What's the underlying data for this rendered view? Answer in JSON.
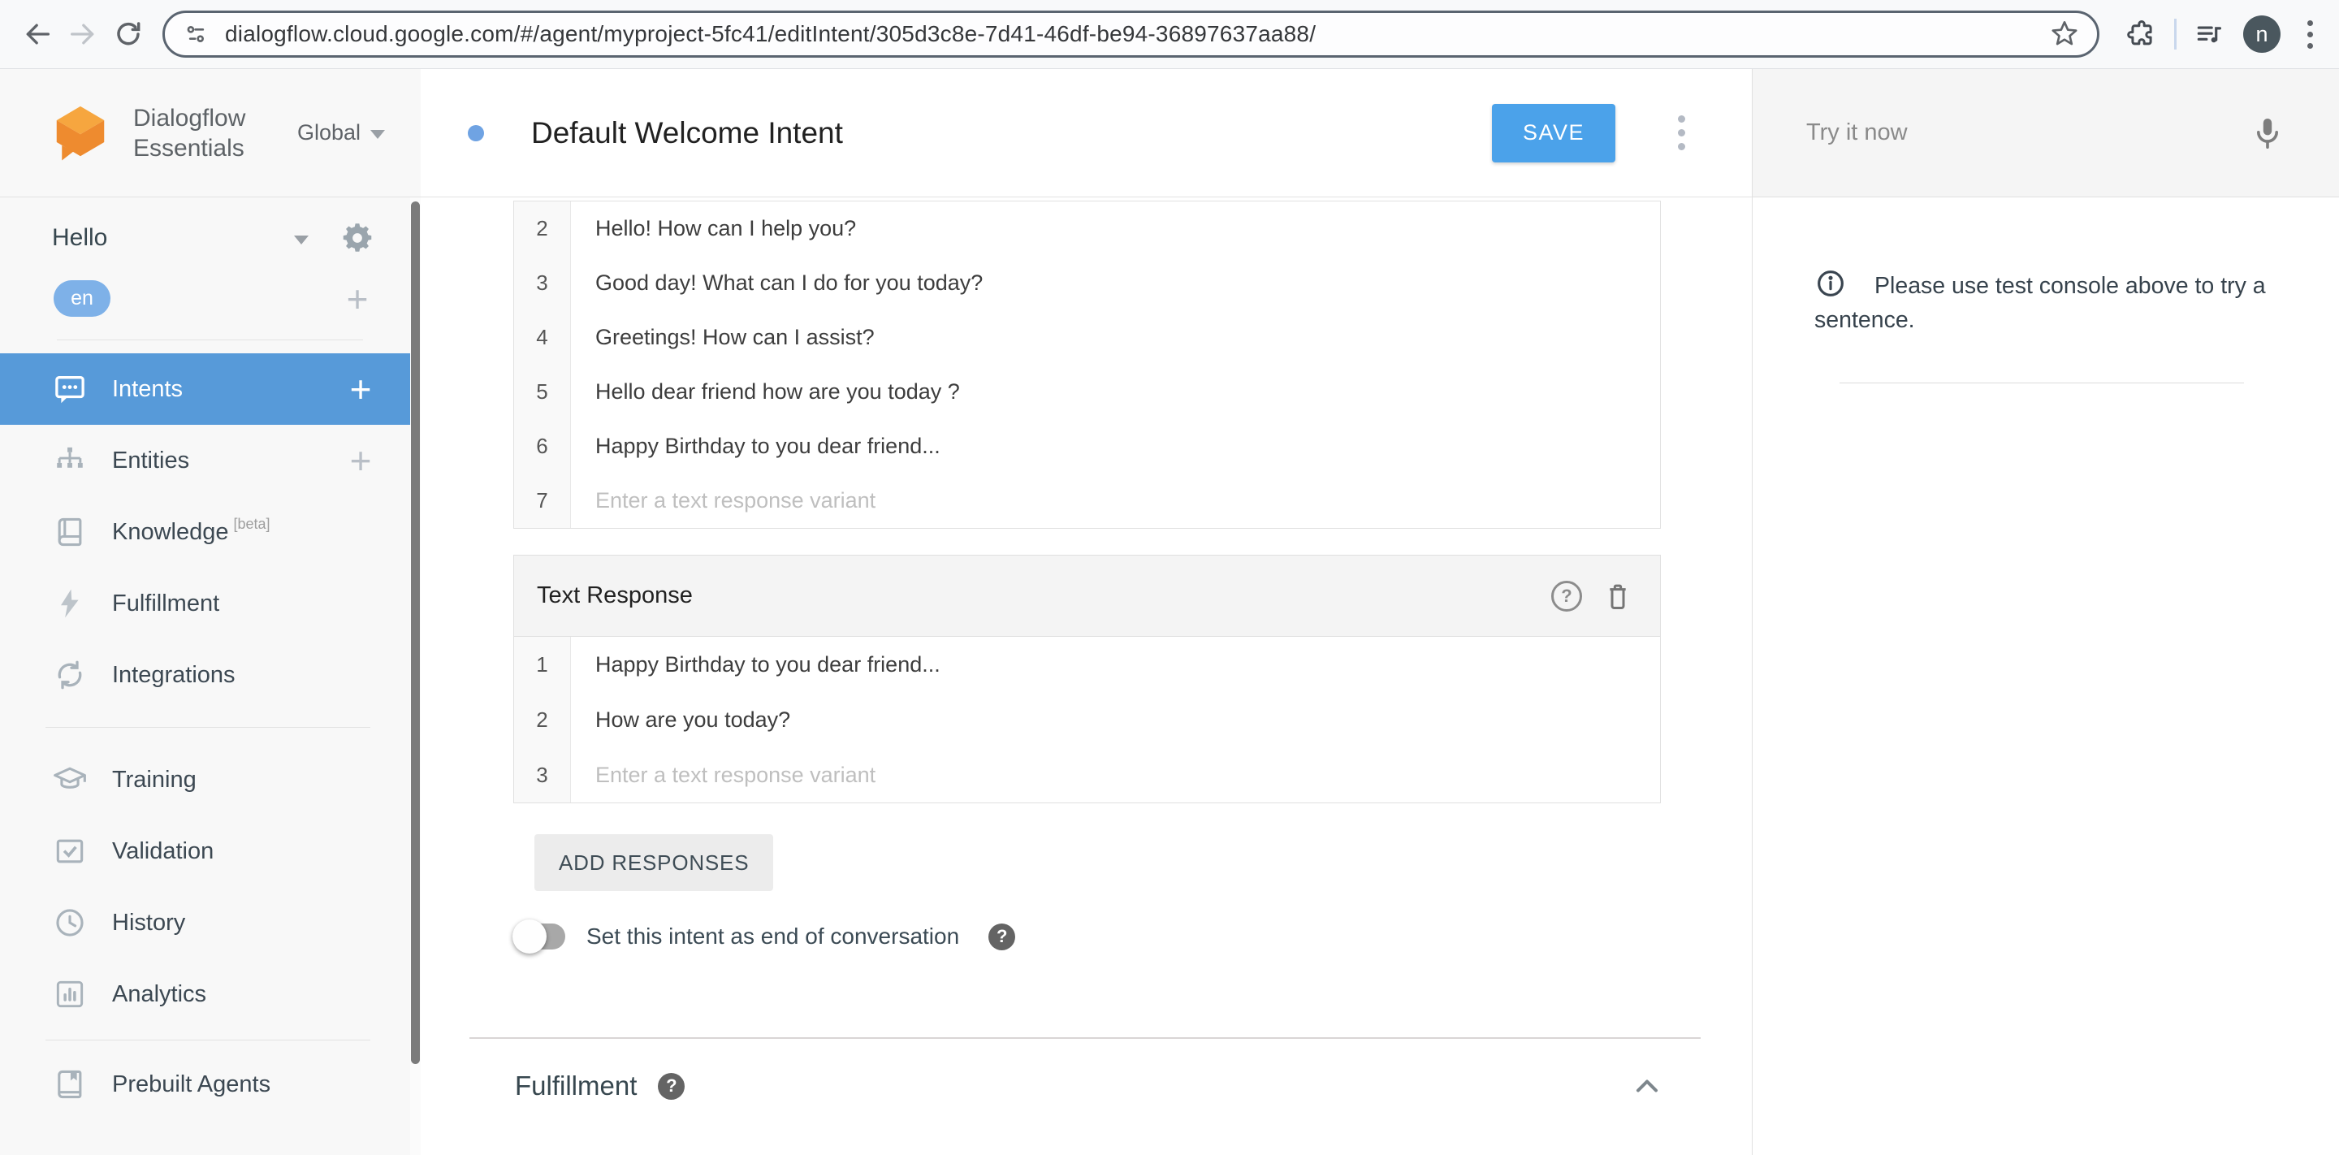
{
  "browser": {
    "url": "dialogflow.cloud.google.com/#/agent/myproject-5fc41/editIntent/305d3c8e-7d41-46df-be94-36897637aa88/",
    "profile_initial": "n"
  },
  "sidebar": {
    "brand_line1": "Dialogflow",
    "brand_line2": "Essentials",
    "region": "Global",
    "agent_name": "Hello",
    "language": "en",
    "add_symbol": "+",
    "menu": [
      {
        "label": "Intents"
      },
      {
        "label": "Entities"
      },
      {
        "label": "Knowledge",
        "badge": "[beta]"
      },
      {
        "label": "Fulfillment"
      },
      {
        "label": "Integrations"
      },
      {
        "label": "Training"
      },
      {
        "label": "Validation"
      },
      {
        "label": "History"
      },
      {
        "label": "Analytics"
      },
      {
        "label": "Prebuilt Agents"
      }
    ]
  },
  "header": {
    "title": "Default Welcome Intent",
    "save_label": "SAVE"
  },
  "content": {
    "top_rows": [
      {
        "num": "2",
        "text": "Hello! How can I help you?"
      },
      {
        "num": "3",
        "text": "Good day! What can I do for you today?"
      },
      {
        "num": "4",
        "text": "Greetings! How can I assist?"
      },
      {
        "num": "5",
        "text": "Hello dear friend how are you today ?"
      },
      {
        "num": "6",
        "text": "Happy Birthday to you dear friend..."
      },
      {
        "num": "7",
        "placeholder": "Enter a text response variant"
      }
    ],
    "text_response": {
      "title": "Text Response",
      "rows": [
        {
          "num": "1",
          "text": "Happy Birthday to you dear friend..."
        },
        {
          "num": "2",
          "text": "How are you today?"
        },
        {
          "num": "3",
          "placeholder": "Enter a text response variant"
        }
      ]
    },
    "add_responses_label": "ADD RESPONSES",
    "end_conversation_label": "Set this intent as end of conversation",
    "fulfillment_title": "Fulfillment"
  },
  "console": {
    "placeholder": "Try it now",
    "hint": "Please use test console above to try a sentence."
  },
  "icons": {
    "help_glyph": "?"
  },
  "colors": {
    "selected_item_blue": "#579ad9",
    "save_button_blue": "#4ba2ea",
    "brand_orange": "#ee8b2f",
    "language_chip_blue": "#7eb1e8",
    "intent_status_dot": "#6fa3e3"
  }
}
